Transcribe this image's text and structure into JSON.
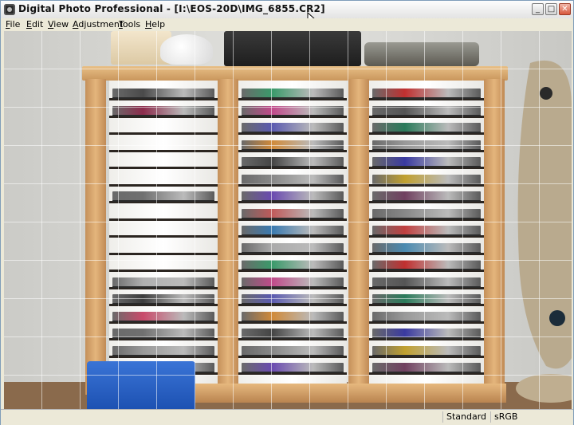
{
  "window": {
    "title": "Digital Photo Professional - [I:\\EOS-20D\\IMG_6855.CR2]",
    "buttons": {
      "minimize": "_",
      "maximize": "□",
      "close": "✕"
    }
  },
  "menu": {
    "items": [
      {
        "accel": "F",
        "rest": "ile"
      },
      {
        "accel": "E",
        "rest": "dit"
      },
      {
        "accel": "V",
        "rest": "iew"
      },
      {
        "accel": "A",
        "rest": "djustment"
      },
      {
        "accel": "T",
        "rest": "ools"
      },
      {
        "accel": "H",
        "rest": "elp"
      }
    ]
  },
  "statusbar": {
    "picture_style": "Standard",
    "color_space": "sRGB"
  },
  "icons": {
    "app": "camera-app-icon",
    "cursor": "mouse-pointer-icon"
  },
  "colors": {
    "accent_close": "#d8573c",
    "frame_wood": "#d9a86e",
    "grid_line": "#ffffff"
  }
}
